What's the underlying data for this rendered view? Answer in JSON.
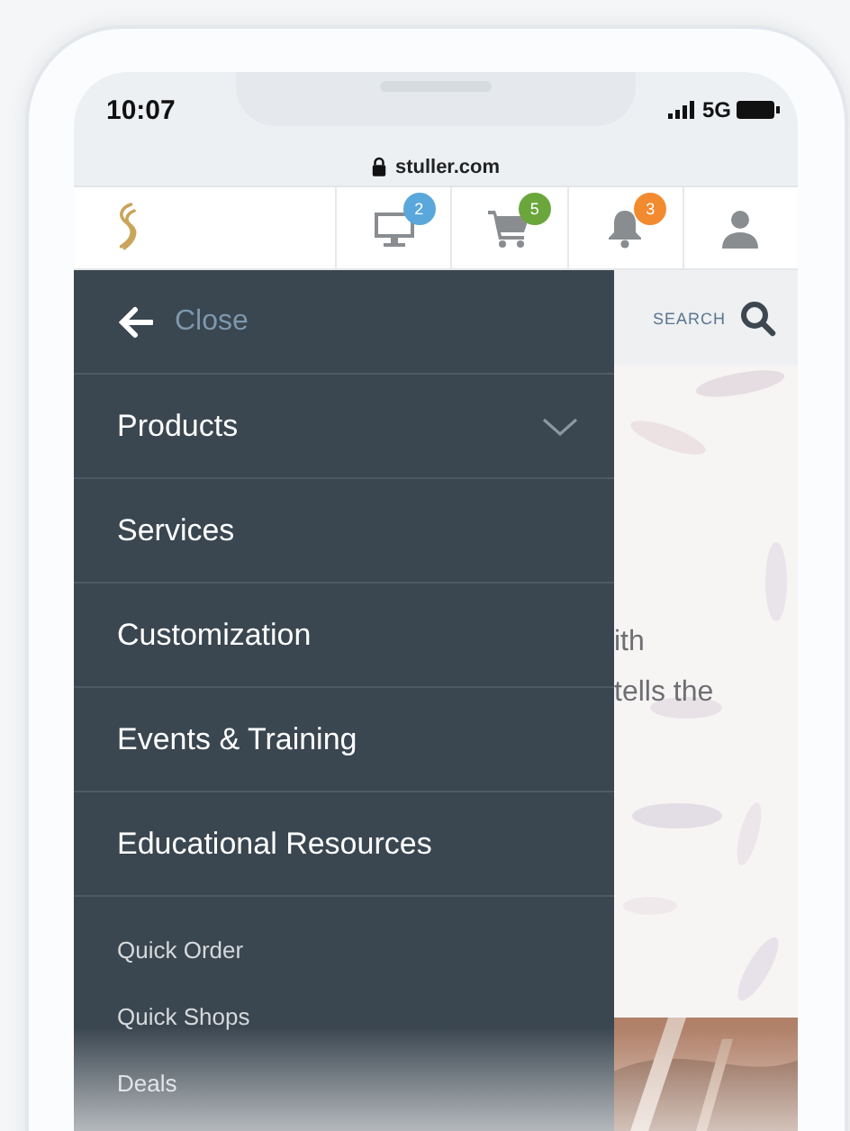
{
  "status_bar": {
    "time": "10:07",
    "network": "5G"
  },
  "address_bar": {
    "url": "stuller.com"
  },
  "header": {
    "icons": [
      {
        "kind": "monitor",
        "badge": "2",
        "color": "#5aa7dc"
      },
      {
        "kind": "cart",
        "badge": "5",
        "color": "#6aa63c"
      },
      {
        "kind": "bell",
        "badge": "3",
        "color": "#f28a30"
      },
      {
        "kind": "user"
      }
    ]
  },
  "drawer": {
    "close_label": "Close",
    "items": [
      {
        "label": "Products",
        "has_submenu": true
      },
      {
        "label": "Services",
        "has_submenu": false
      },
      {
        "label": "Customization",
        "has_submenu": false
      },
      {
        "label": "Events & Training",
        "has_submenu": false
      },
      {
        "label": "Educational Resources",
        "has_submenu": false
      }
    ],
    "secondary_items": [
      "Quick Order",
      "Quick Shops",
      "Deals"
    ]
  },
  "search": {
    "label": "SEARCH"
  },
  "background_text": [
    "ith",
    "tells the"
  ]
}
